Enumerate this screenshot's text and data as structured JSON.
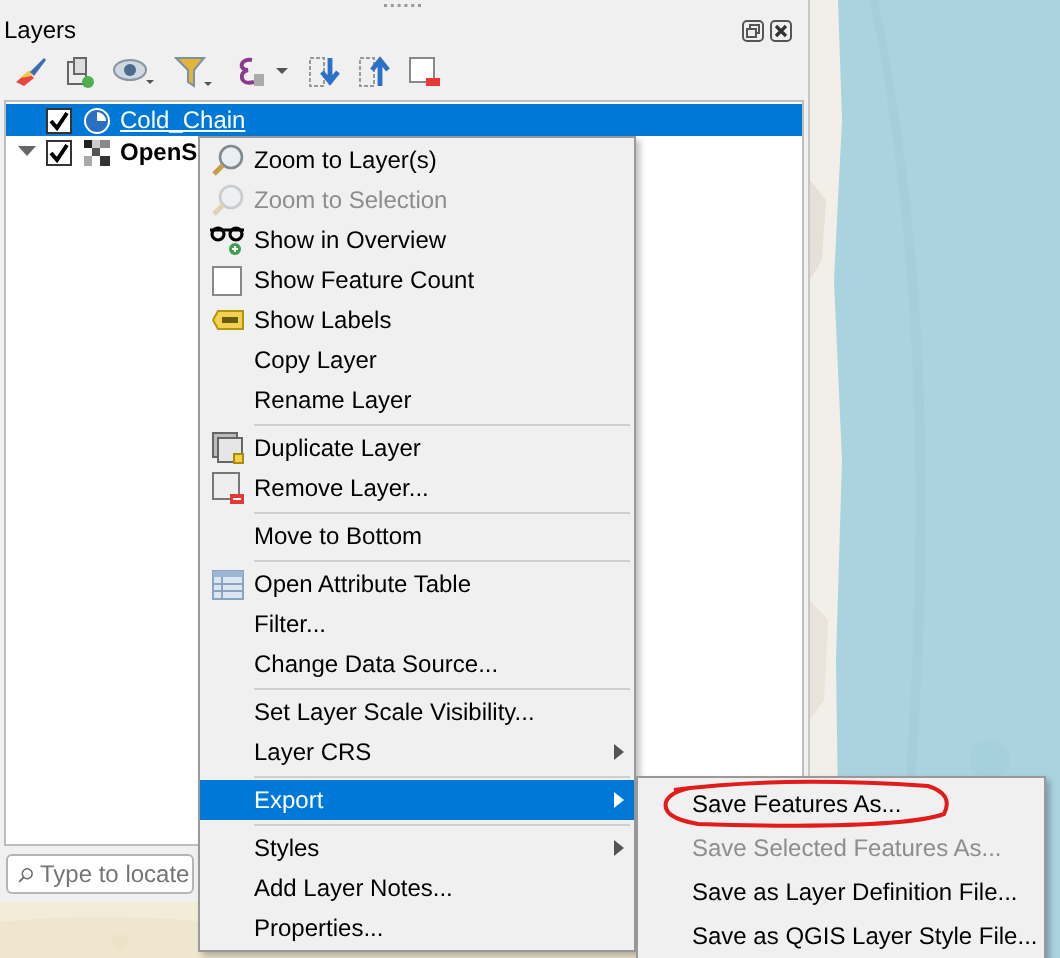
{
  "panel": {
    "title": "Layers"
  },
  "layers": [
    {
      "name": "Cold_Chain",
      "kind": "vector",
      "checked": true,
      "selected": true,
      "expanded": false
    },
    {
      "name": "OpenS",
      "kind": "raster",
      "checked": true,
      "selected": false,
      "expanded": true
    }
  ],
  "search": {
    "placeholder": "Type to locate"
  },
  "context_menu": [
    {
      "kind": "zoom",
      "label": "Zoom to Layer(s)",
      "disabled": false,
      "selected": false
    },
    {
      "kind": "zoom",
      "label": "Zoom to Selection",
      "disabled": true,
      "selected": false
    },
    {
      "kind": "overview",
      "label": "Show in Overview",
      "disabled": false,
      "selected": false
    },
    {
      "kind": "checkbox",
      "label": "Show Feature Count",
      "checked": false,
      "disabled": false,
      "selected": false
    },
    {
      "kind": "labels",
      "label": "Show Labels",
      "disabled": false,
      "selected": false
    },
    {
      "kind": "plain",
      "label": "Copy Layer",
      "disabled": false,
      "selected": false
    },
    {
      "kind": "plain",
      "label": "Rename Layer",
      "disabled": false,
      "selected": false
    },
    {
      "kind": "separator"
    },
    {
      "kind": "duplicate",
      "label": "Duplicate Layer",
      "disabled": false,
      "selected": false
    },
    {
      "kind": "remove",
      "label": "Remove Layer...",
      "disabled": false,
      "selected": false
    },
    {
      "kind": "separator"
    },
    {
      "kind": "plain",
      "label": "Move to Bottom",
      "disabled": false,
      "selected": false
    },
    {
      "kind": "separator"
    },
    {
      "kind": "table",
      "label": "Open Attribute Table",
      "disabled": false,
      "selected": false
    },
    {
      "kind": "plain",
      "label": "Filter...",
      "disabled": false,
      "selected": false
    },
    {
      "kind": "plain",
      "label": "Change Data Source...",
      "disabled": false,
      "selected": false
    },
    {
      "kind": "separator"
    },
    {
      "kind": "plain",
      "label": "Set Layer Scale Visibility...",
      "disabled": false,
      "selected": false
    },
    {
      "kind": "submenu",
      "label": "Layer CRS",
      "disabled": false,
      "selected": false
    },
    {
      "kind": "separator"
    },
    {
      "kind": "submenu",
      "label": "Export",
      "disabled": false,
      "selected": true
    },
    {
      "kind": "separator"
    },
    {
      "kind": "submenu",
      "label": "Styles",
      "disabled": false,
      "selected": false
    },
    {
      "kind": "plain",
      "label": "Add Layer Notes...",
      "disabled": false,
      "selected": false
    },
    {
      "kind": "plain",
      "label": "Properties...",
      "disabled": false,
      "selected": false
    }
  ],
  "export_submenu": [
    {
      "label": "Save Features As...",
      "disabled": false,
      "circled": true
    },
    {
      "label": "Save Selected Features As...",
      "disabled": true,
      "circled": false
    },
    {
      "label": "Save as Layer Definition File...",
      "disabled": false,
      "circled": false
    },
    {
      "label": "Save as QGIS Layer Style File...",
      "disabled": false,
      "circled": false
    }
  ]
}
